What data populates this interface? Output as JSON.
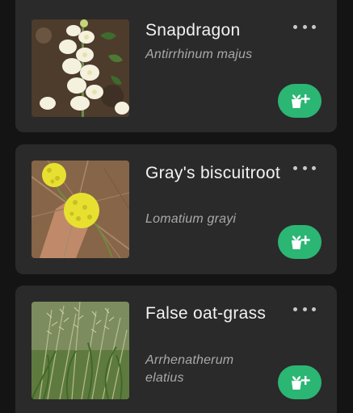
{
  "plants": [
    {
      "common_name": "Snapdragon",
      "scientific_name": "Antirrhinum majus",
      "photo": "snapdragon-photo"
    },
    {
      "common_name": "Gray's biscuitroot",
      "scientific_name": "Lomatium grayi",
      "photo": "biscuitroot-photo"
    },
    {
      "common_name": "False oat-grass",
      "scientific_name": "Arrhenatherum elatius",
      "photo": "oat-grass-photo"
    }
  ],
  "icons": {
    "more": "more-options-icon",
    "add": "add-to-garden-icon"
  },
  "colors": {
    "background": "#141414",
    "card": "#2a2a2a",
    "accent": "#2bb673",
    "title": "#f2f2f2",
    "subtitle": "#a9a9a9"
  }
}
